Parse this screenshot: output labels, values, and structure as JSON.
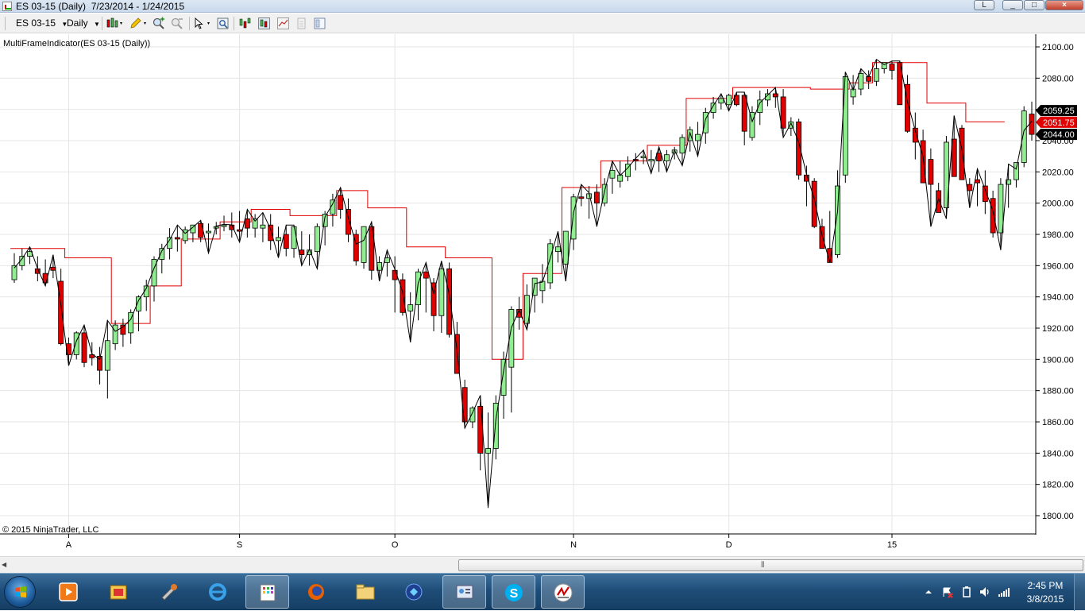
{
  "window": {
    "title": "ES 03-15 (Daily)  7/23/2014 - 1/24/2015",
    "buttons": [
      "L",
      "_",
      "□",
      "×"
    ]
  },
  "toolbar": {
    "instrument": "ES 03-15",
    "interval": "Daily",
    "icons": [
      "bar-style-icon",
      "draw-pencil-icon",
      "zoom-in-icon",
      "zoom-out-icon",
      "pointer-icon",
      "properties-icon",
      "indicators-icon",
      "strategies-icon",
      "line-chart-icon",
      "data-box-icon",
      "template-icon"
    ]
  },
  "chart": {
    "indicator_label": "MultiFrameIndicator(ES 03-15 (Daily))",
    "copyright": "© 2015 NinjaTrader, LLC",
    "colors": {
      "up": "#90ee90",
      "down": "#e00000",
      "outline": "#000000",
      "mtf_line": "#e00000",
      "swing_line": "#000000",
      "grid": "#e5e5e5"
    },
    "price_flags": [
      {
        "label": "2059.25",
        "color": "#000000"
      },
      {
        "label": "2051.75",
        "color": "#e00000"
      },
      {
        "label": "2044.00",
        "color": "#000000"
      }
    ]
  },
  "chart_data": {
    "type": "candlestick",
    "title": "ES 03-15 (Daily)",
    "x_ticks": [
      {
        "label": "A",
        "index": 7
      },
      {
        "label": "S",
        "index": 29
      },
      {
        "label": "O",
        "index": 49
      },
      {
        "label": "N",
        "index": 72
      },
      {
        "label": "D",
        "index": 92
      },
      {
        "label": "15",
        "index": 113
      }
    ],
    "y_ticks": [
      "1800.00",
      "1820.00",
      "1840.00",
      "1860.00",
      "1880.00",
      "1900.00",
      "1920.00",
      "1940.00",
      "1960.00",
      "1980.00",
      "2000.00",
      "2020.00",
      "2040.00",
      "2060.00",
      "2080.00",
      "2100.00"
    ],
    "ylim": [
      1794,
      2104
    ],
    "ohlc": [
      [
        1951,
        1968,
        1949,
        1960
      ],
      [
        1960,
        1971,
        1957,
        1966
      ],
      [
        1966,
        1972,
        1961,
        1969
      ],
      [
        1958,
        1966,
        1950,
        1955
      ],
      [
        1955,
        1964,
        1947,
        1949
      ],
      [
        1959,
        1967,
        1952,
        1957
      ],
      [
        1950,
        1958,
        1909,
        1910
      ],
      [
        1910,
        1914,
        1896,
        1903
      ],
      [
        1903,
        1918,
        1900,
        1917
      ],
      [
        1917,
        1922,
        1895,
        1898
      ],
      [
        1903,
        1911,
        1896,
        1901
      ],
      [
        1902,
        1908,
        1884,
        1893
      ],
      [
        1893,
        1925,
        1875,
        1912
      ],
      [
        1910,
        1925,
        1906,
        1922
      ],
      [
        1922,
        1926,
        1908,
        1916
      ],
      [
        1917,
        1932,
        1910,
        1930
      ],
      [
        1931,
        1941,
        1918,
        1940
      ],
      [
        1940,
        1951,
        1931,
        1947
      ],
      [
        1947,
        1966,
        1937,
        1964
      ],
      [
        1964,
        1974,
        1955,
        1971
      ],
      [
        1971,
        1984,
        1964,
        1978
      ],
      [
        1978,
        1986,
        1969,
        1977
      ],
      [
        1976,
        1985,
        1974,
        1983
      ],
      [
        1981,
        1986,
        1975,
        1986
      ],
      [
        1987,
        1989,
        1975,
        1978
      ],
      [
        1981,
        1987,
        1968,
        1982
      ],
      [
        1984,
        1988,
        1980,
        1985
      ],
      [
        1985,
        1992,
        1982,
        1986
      ],
      [
        1986,
        1994,
        1978,
        1983
      ],
      [
        1983,
        1995,
        1975,
        1982
      ],
      [
        1990,
        1996,
        1978,
        1984
      ],
      [
        1984,
        1993,
        1978,
        1990
      ],
      [
        1984,
        1994,
        1975,
        1986
      ],
      [
        1986,
        1993,
        1970,
        1976
      ],
      [
        1976,
        1985,
        1965,
        1978
      ],
      [
        1980,
        1986,
        1966,
        1971
      ],
      [
        1971,
        1986,
        1965,
        1985
      ],
      [
        1970,
        1982,
        1960,
        1967
      ],
      [
        1967,
        1980,
        1960,
        1970
      ],
      [
        1969,
        1987,
        1958,
        1985
      ],
      [
        1985,
        1995,
        1973,
        1993
      ],
      [
        1993,
        2006,
        1985,
        2002
      ],
      [
        2005,
        2010,
        1990,
        1996
      ],
      [
        1996,
        2003,
        1975,
        1980
      ],
      [
        1980,
        1983,
        1960,
        1963
      ],
      [
        1962,
        1985,
        1958,
        1985
      ],
      [
        1985,
        1988,
        1951,
        1957
      ],
      [
        1957,
        1966,
        1950,
        1962
      ],
      [
        1962,
        1970,
        1953,
        1965
      ],
      [
        1957,
        1966,
        1930,
        1951
      ],
      [
        1951,
        1955,
        1928,
        1930
      ],
      [
        1931,
        1943,
        1911,
        1935
      ],
      [
        1935,
        1958,
        1925,
        1956
      ],
      [
        1956,
        1962,
        1930,
        1952
      ],
      [
        1949,
        1952,
        1918,
        1928
      ],
      [
        1928,
        1963,
        1917,
        1958
      ],
      [
        1958,
        1962,
        1914,
        1916
      ],
      [
        1916,
        1924,
        1898,
        1891
      ],
      [
        1882,
        1887,
        1856,
        1860
      ],
      [
        1860,
        1870,
        1856,
        1869
      ],
      [
        1870,
        1877,
        1829,
        1840
      ],
      [
        1840,
        1866,
        1805,
        1843
      ],
      [
        1843,
        1877,
        1836,
        1872
      ],
      [
        1877,
        1905,
        1862,
        1900
      ],
      [
        1895,
        1934,
        1866,
        1932
      ],
      [
        1932,
        1940,
        1919,
        1927
      ],
      [
        1923,
        1948,
        1919,
        1941
      ],
      [
        1941,
        1951,
        1930,
        1952
      ],
      [
        1944,
        1961,
        1936,
        1950
      ],
      [
        1949,
        1977,
        1945,
        1974
      ],
      [
        1969,
        1982,
        1962,
        1972
      ],
      [
        1961,
        1980,
        1950,
        1982
      ],
      [
        1977,
        2006,
        1970,
        2004
      ],
      [
        2004,
        2012,
        1998,
        2003
      ],
      [
        2003,
        2011,
        1990,
        2006
      ],
      [
        2007,
        2012,
        1985,
        2000
      ],
      [
        2000,
        2016,
        1998,
        2012
      ],
      [
        2016,
        2027,
        2006,
        2021
      ],
      [
        2014,
        2027,
        2010,
        2018
      ],
      [
        2017,
        2030,
        2014,
        2025
      ],
      [
        2028,
        2032,
        2021,
        2027
      ],
      [
        2029,
        2034,
        2025,
        2030
      ],
      [
        2027,
        2034,
        2019,
        2028
      ],
      [
        2032,
        2036,
        2020,
        2027
      ],
      [
        2027,
        2034,
        2020,
        2031
      ],
      [
        2032,
        2036,
        2028,
        2034
      ],
      [
        2032,
        2044,
        2024,
        2042
      ],
      [
        2040,
        2049,
        2033,
        2047
      ],
      [
        2040,
        2052,
        2030,
        2044
      ],
      [
        2045,
        2061,
        2038,
        2058
      ],
      [
        2058,
        2068,
        2054,
        2064
      ],
      [
        2064,
        2070,
        2060,
        2067
      ],
      [
        2063,
        2070,
        2059,
        2069
      ],
      [
        2069,
        2071,
        2062,
        2063
      ],
      [
        2069,
        2071,
        2037,
        2046
      ],
      [
        2042,
        2062,
        2040,
        2058
      ],
      [
        2058,
        2072,
        2050,
        2066
      ],
      [
        2066,
        2073,
        2062,
        2070
      ],
      [
        2070,
        2074,
        2061,
        2068
      ],
      [
        2068,
        2073,
        2042,
        2048
      ],
      [
        2048,
        2055,
        2043,
        2052
      ],
      [
        2052,
        2054,
        2015,
        2018
      ],
      [
        2018,
        2024,
        1998,
        2014
      ],
      [
        2014,
        2016,
        1984,
        1985
      ],
      [
        1985,
        1990,
        1975,
        1971
      ],
      [
        1971,
        1995,
        1962,
        1962
      ],
      [
        1967,
        2021,
        1965,
        2011
      ],
      [
        2018,
        2084,
        2013,
        2081
      ],
      [
        2068,
        2082,
        2063,
        2073
      ],
      [
        2073,
        2086,
        2069,
        2083
      ],
      [
        2081,
        2085,
        2073,
        2078
      ],
      [
        2078,
        2092,
        2075,
        2086
      ],
      [
        2086,
        2089,
        2083,
        2090
      ],
      [
        2089,
        2091,
        2079,
        2085
      ],
      [
        2090,
        2091,
        2068,
        2063
      ],
      [
        2076,
        2082,
        2045,
        2046
      ],
      [
        2048,
        2058,
        2028,
        2039
      ],
      [
        2040,
        2047,
        2013,
        2013
      ],
      [
        2028,
        2035,
        1985,
        2012
      ],
      [
        2008,
        2013,
        1994,
        1994
      ],
      [
        1997,
        2043,
        1990,
        2039
      ],
      [
        2041,
        2056,
        2017,
        2017
      ],
      [
        2048,
        2050,
        2020,
        2015
      ],
      [
        2012,
        2016,
        1997,
        2008
      ],
      [
        2015,
        2022,
        1998,
        2013
      ],
      [
        2011,
        2021,
        1993,
        2001
      ],
      [
        2003,
        2008,
        1978,
        1981
      ],
      [
        1981,
        2016,
        1970,
        2012
      ],
      [
        2012,
        2025,
        1997,
        2015
      ],
      [
        2015,
        2023,
        2010,
        2026
      ],
      [
        2026,
        2062,
        2023,
        2059
      ],
      [
        2057,
        2065,
        2040,
        2044
      ]
    ],
    "mtf_steps": [
      {
        "from": 0,
        "to": 6,
        "value": 1971
      },
      {
        "from": 7,
        "to": 12,
        "value": 1965
      },
      {
        "from": 13,
        "to": 17,
        "value": 1923
      },
      {
        "from": 18,
        "to": 21,
        "value": 1947
      },
      {
        "from": 22,
        "to": 26,
        "value": 1977
      },
      {
        "from": 27,
        "to": 30,
        "value": 1988
      },
      {
        "from": 31,
        "to": 35,
        "value": 1996
      },
      {
        "from": 36,
        "to": 41,
        "value": 1992
      },
      {
        "from": 42,
        "to": 45,
        "value": 2008
      },
      {
        "from": 46,
        "to": 50,
        "value": 1997
      },
      {
        "from": 51,
        "to": 55,
        "value": 1972
      },
      {
        "from": 56,
        "to": 61,
        "value": 1965
      },
      {
        "from": 62,
        "to": 65,
        "value": 1900
      },
      {
        "from": 66,
        "to": 70,
        "value": 1955
      },
      {
        "from": 71,
        "to": 75,
        "value": 2010
      },
      {
        "from": 76,
        "to": 81,
        "value": 2027
      },
      {
        "from": 82,
        "to": 86,
        "value": 2037
      },
      {
        "from": 87,
        "to": 92,
        "value": 2067
      },
      {
        "from": 93,
        "to": 102,
        "value": 2074
      },
      {
        "from": 103,
        "to": 107,
        "value": 2073
      },
      {
        "from": 108,
        "to": 110,
        "value": 2077
      },
      {
        "from": 111,
        "to": 117,
        "value": 2090
      },
      {
        "from": 118,
        "to": 122,
        "value": 2064
      },
      {
        "from": 123,
        "to": 127,
        "value": 2052
      }
    ]
  },
  "taskbar": {
    "apps": [
      "media-player-icon",
      "store-icon",
      "tools-icon",
      "internet-explorer-icon",
      "calculator-icon",
      "firefox-icon",
      "file-explorer-icon",
      "media-center-icon",
      "control-panel-icon",
      "skype-icon",
      "ninjatrader-icon"
    ],
    "clock_time": "2:45 PM",
    "clock_date": "3/8/2015"
  }
}
